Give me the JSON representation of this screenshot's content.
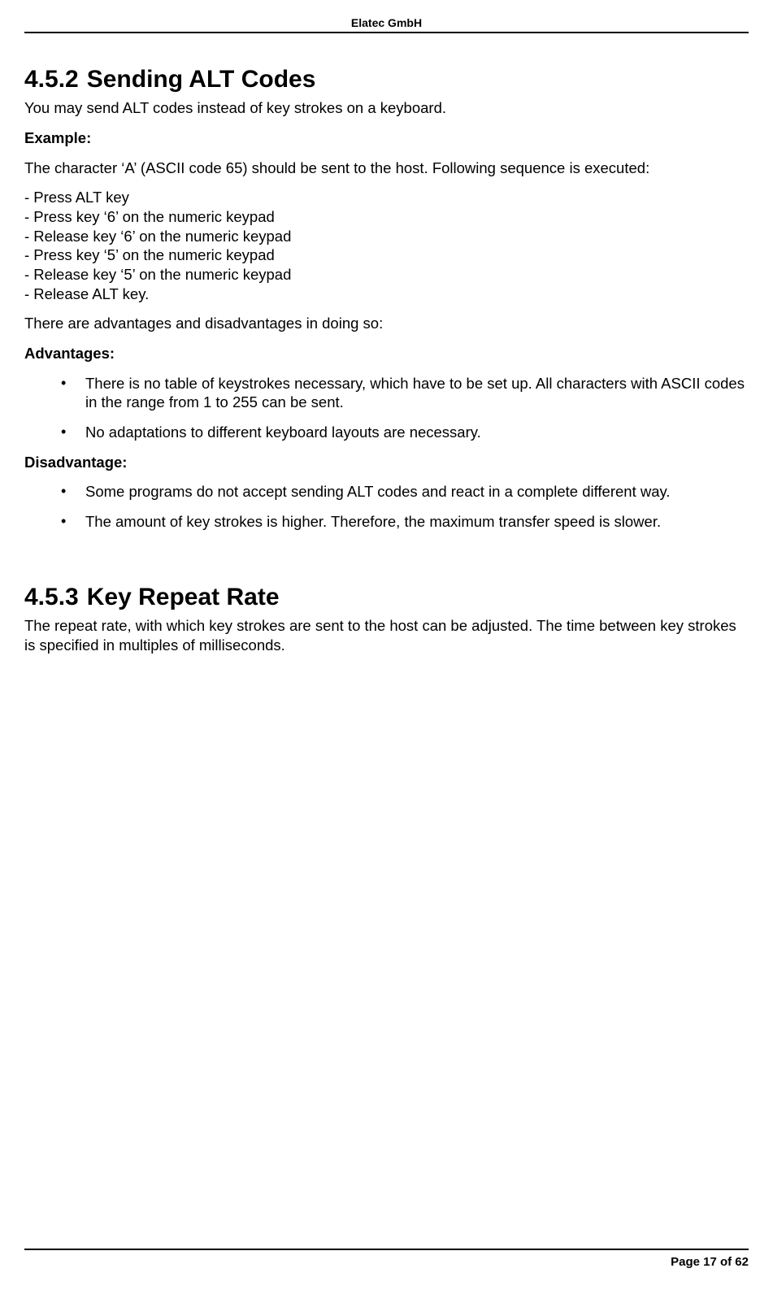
{
  "header": {
    "company": "Elatec GmbH"
  },
  "section1": {
    "number": "4.5.2",
    "title": "Sending ALT Codes",
    "intro": "You may send ALT codes instead of key strokes on a keyboard.",
    "example_label": "Example:",
    "example_text": "The character ‘A’ (ASCII code 65) should be sent to the host. Following sequence is executed:",
    "sequence": [
      "- Press ALT key",
      "- Press key ‘6’ on the numeric keypad",
      "- Release key ‘6’ on the numeric keypad",
      "- Press key ‘5’ on the numeric keypad",
      "- Release key ‘5’ on the numeric keypad",
      "- Release ALT key."
    ],
    "adv_disadv_intro": "There are advantages and disadvantages in doing so:",
    "advantages_label": "Advantages:",
    "advantages": [
      "There is no table of keystrokes necessary, which have to be set up. All characters with ASCII codes in the range from 1 to 255 can be sent.",
      "No adaptations to different keyboard layouts are necessary."
    ],
    "disadvantage_label": "Disadvantage:",
    "disadvantages": [
      "Some programs do not accept sending ALT codes and react in a complete different way.",
      "The amount of key strokes is higher. Therefore, the maximum transfer speed is slower."
    ]
  },
  "section2": {
    "number": "4.5.3",
    "title": "Key Repeat Rate",
    "text": "The repeat rate, with which key strokes are sent to the host can be adjusted. The time between key strokes is specified in multiples of milliseconds."
  },
  "footer": {
    "page": "Page 17 of 62"
  }
}
